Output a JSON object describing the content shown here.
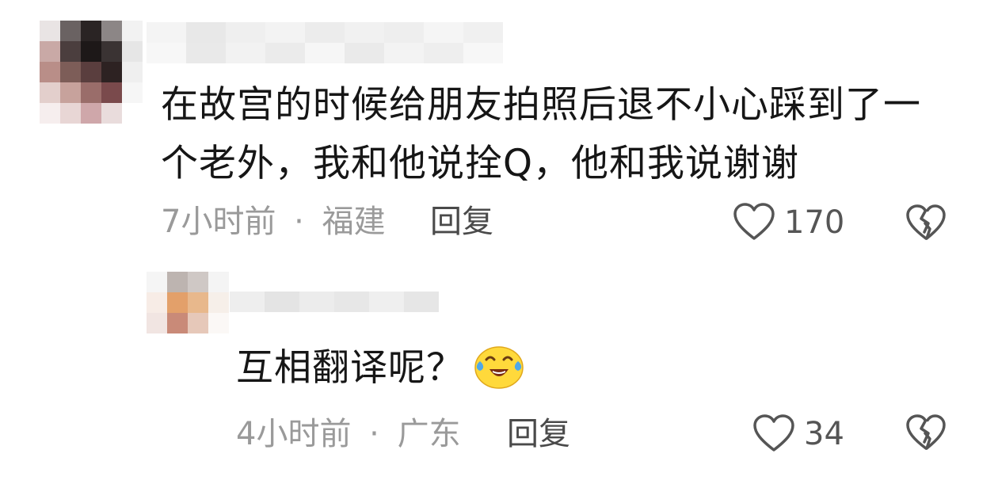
{
  "comments": [
    {
      "text_lines": [
        "在故宫的时候给朋友拍照后退不小心踩到了一",
        "个老外，我和他说拴Q，他和我说谢谢"
      ],
      "time": "7小时前",
      "location": "福建",
      "separator": "·",
      "reply_label": "回复",
      "like_count": "170",
      "like_icon": "heart-outline-icon",
      "dislike_icon": "broken-heart-icon"
    }
  ],
  "replies": [
    {
      "text": "互相翻译呢？",
      "emoji": "laughing-crying-emoji",
      "time": "4小时前",
      "location": "广东",
      "separator": "·",
      "reply_label": "回复",
      "like_count": "34",
      "like_icon": "heart-outline-icon",
      "dislike_icon": "broken-heart-icon"
    }
  ],
  "colors": {
    "text": "#161616",
    "meta": "#9a9a9a",
    "reply": "#4a4a4a",
    "icon": "#555555",
    "emoji_face": "#ffd93b",
    "emoji_tears": "#4fa8e8"
  }
}
